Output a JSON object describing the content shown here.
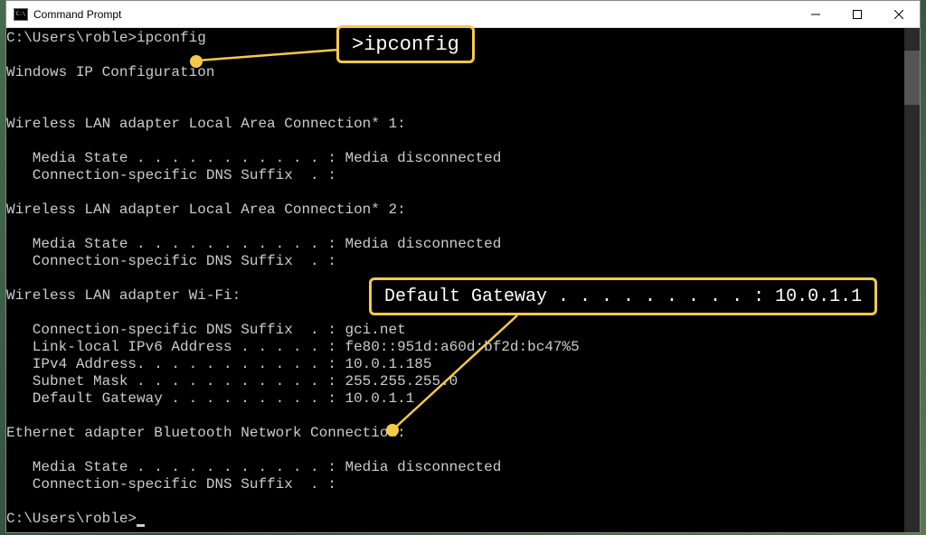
{
  "window": {
    "title": "Command Prompt"
  },
  "callouts": {
    "ipconfig": ">ipconfig",
    "gateway": "Default Gateway . . . . . . . . . : 10.0.1.1"
  },
  "terminal": {
    "prompt1": "C:\\Users\\roble>ipconfig",
    "heading": "Windows IP Configuration",
    "adapter1_title": "Wireless LAN adapter Local Area Connection* 1:",
    "adapter1_media": "   Media State . . . . . . . . . . . : Media disconnected",
    "adapter1_dns": "   Connection-specific DNS Suffix  . :",
    "adapter2_title": "Wireless LAN adapter Local Area Connection* 2:",
    "adapter2_media": "   Media State . . . . . . . . . . . : Media disconnected",
    "adapter2_dns": "   Connection-specific DNS Suffix  . :",
    "adapter3_title": "Wireless LAN adapter Wi-Fi:",
    "adapter3_dns": "   Connection-specific DNS Suffix  . : gci.net",
    "adapter3_ipv6": "   Link-local IPv6 Address . . . . . : fe80::951d:a60d:bf2d:bc47%5",
    "adapter3_ipv4": "   IPv4 Address. . . . . . . . . . . : 10.0.1.185",
    "adapter3_subnet": "   Subnet Mask . . . . . . . . . . . : 255.255.255.0",
    "adapter3_gw": "   Default Gateway . . . . . . . . . : 10.0.1.1",
    "adapter4_title": "Ethernet adapter Bluetooth Network Connection:",
    "adapter4_media": "   Media State . . . . . . . . . . . : Media disconnected",
    "adapter4_dns": "   Connection-specific DNS Suffix  . :",
    "prompt2": "C:\\Users\\roble>"
  }
}
